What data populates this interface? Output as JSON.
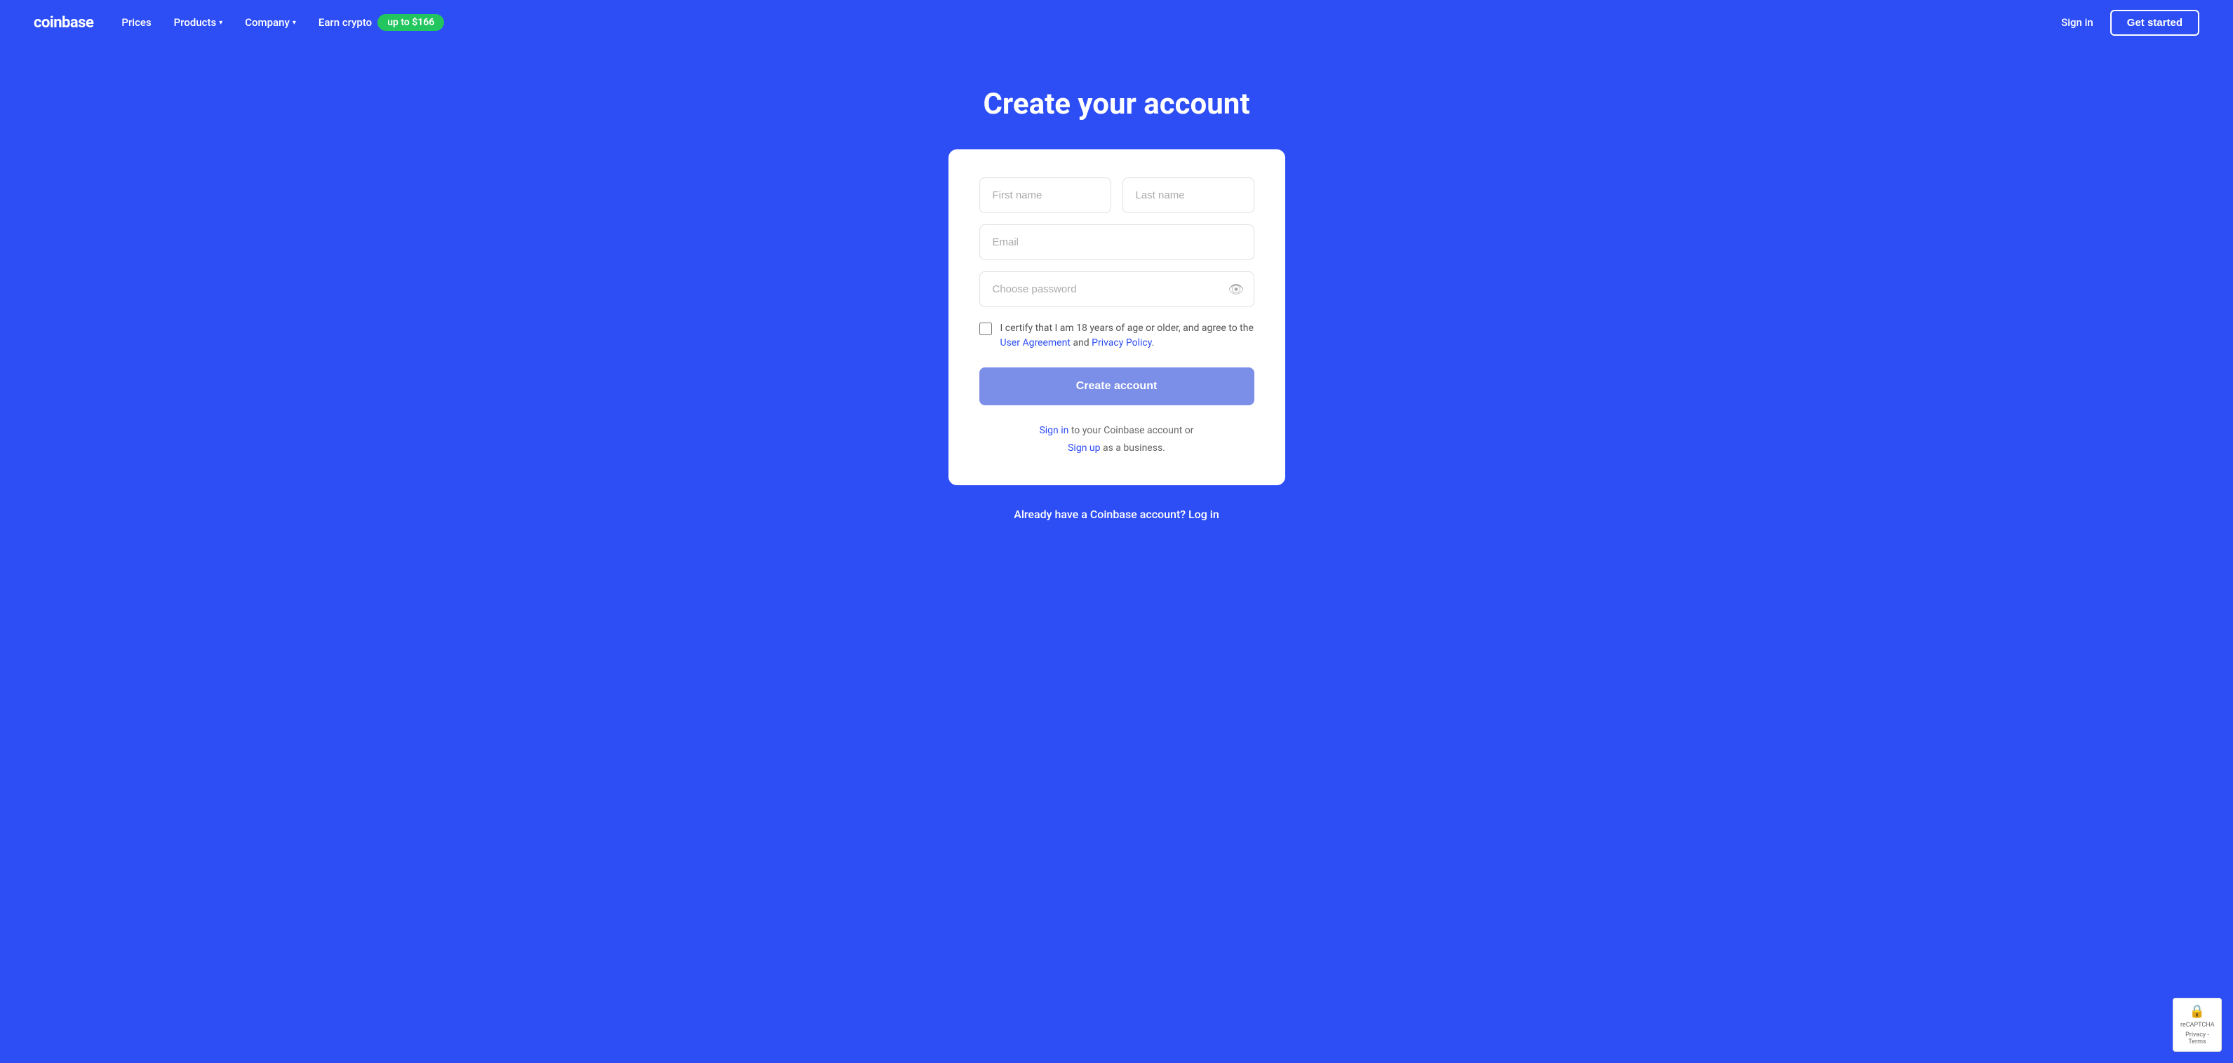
{
  "brand": {
    "logo": "coinbase"
  },
  "navbar": {
    "links": [
      {
        "label": "Prices",
        "hasDropdown": false
      },
      {
        "label": "Products",
        "hasDropdown": true
      },
      {
        "label": "Company",
        "hasDropdown": true
      }
    ],
    "earn": {
      "label": "Earn crypto",
      "badge": "up to $166"
    },
    "right": {
      "signin": "Sign in",
      "getStarted": "Get started"
    }
  },
  "page": {
    "title": "Create your account"
  },
  "form": {
    "firstName": {
      "placeholder": "First name"
    },
    "lastName": {
      "placeholder": "Last name"
    },
    "email": {
      "placeholder": "Email"
    },
    "password": {
      "placeholder": "Choose password"
    },
    "checkbox": {
      "text": "I certify that I am 18 years of age or older, and agree to the",
      "userAgreement": "User Agreement",
      "and": "and",
      "privacyPolicy": "Privacy Policy",
      "period": "."
    },
    "createButton": "Create account",
    "footer": {
      "signinLabel": "Sign in",
      "signinText": "to your Coinbase account or",
      "signupLabel": "Sign up",
      "signupText": "as a business."
    }
  },
  "bottom": {
    "text": "Already have a Coinbase account? Log in"
  },
  "recaptcha": {
    "text": "reCAPTCHA",
    "subtext": "Privacy - Terms"
  }
}
